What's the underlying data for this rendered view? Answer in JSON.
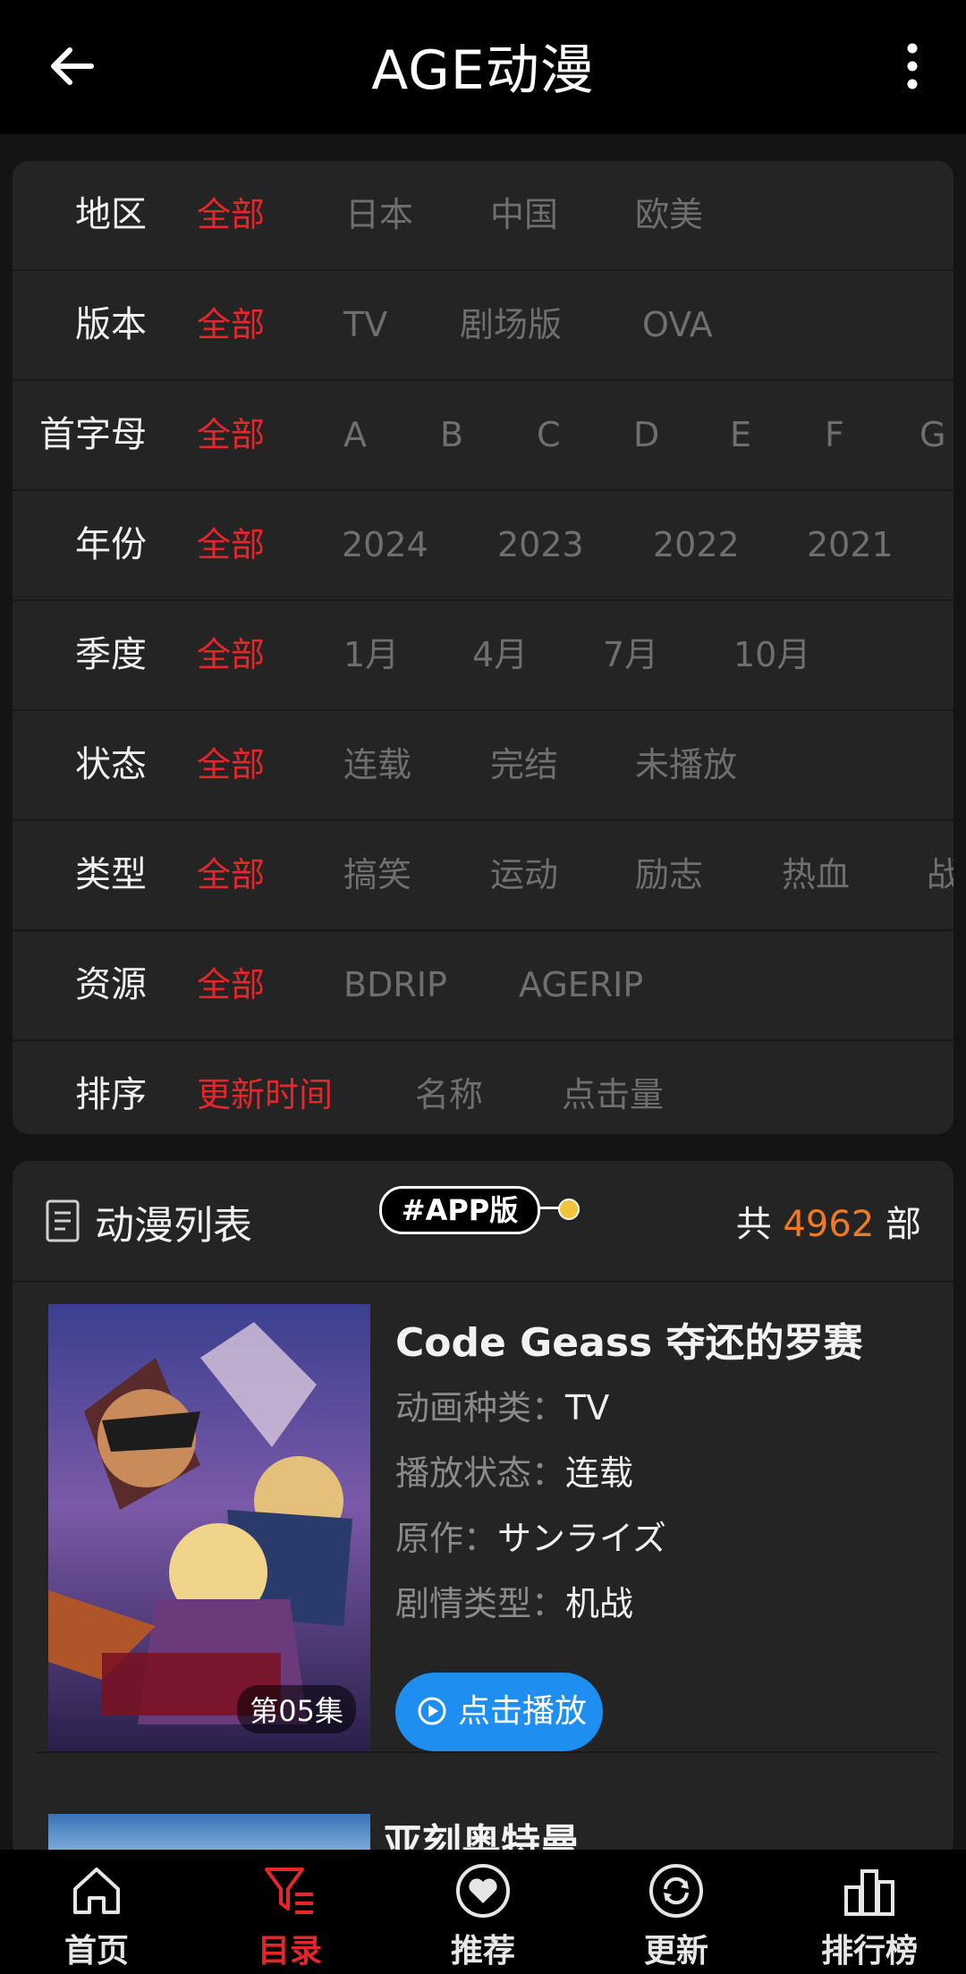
{
  "app": {
    "title": "AGE动漫"
  },
  "filters": [
    {
      "label": "地区",
      "options": [
        "全部",
        "日本",
        "中国",
        "欧美"
      ],
      "selected": 0
    },
    {
      "label": "版本",
      "options": [
        "全部",
        "TV",
        "剧场版",
        "OVA"
      ],
      "selected": 0
    },
    {
      "label": "首字母",
      "options": [
        "全部",
        "A",
        "B",
        "C",
        "D",
        "E",
        "F",
        "G"
      ],
      "selected": 0
    },
    {
      "label": "年份",
      "options": [
        "全部",
        "2024",
        "2023",
        "2022",
        "2021"
      ],
      "selected": 0
    },
    {
      "label": "季度",
      "options": [
        "全部",
        "1月",
        "4月",
        "7月",
        "10月"
      ],
      "selected": 0
    },
    {
      "label": "状态",
      "options": [
        "全部",
        "连载",
        "完结",
        "未播放"
      ],
      "selected": 0
    },
    {
      "label": "类型",
      "options": [
        "全部",
        "搞笑",
        "运动",
        "励志",
        "热血",
        "战"
      ],
      "selected": 0
    },
    {
      "label": "资源",
      "options": [
        "全部",
        "BDRIP",
        "AGERIP"
      ],
      "selected": 0
    },
    {
      "label": "排序",
      "options": [
        "更新时间",
        "名称",
        "点击量"
      ],
      "selected": 0
    }
  ],
  "list": {
    "title": "动漫列表",
    "count_prefix": "共",
    "count": "4962",
    "count_suffix": "部",
    "tag": "#APP版",
    "items": [
      {
        "name": "Code Geass 夺还的罗赛",
        "episode_badge": "第05集",
        "fields": [
          {
            "key": "动画种类：",
            "value": "TV"
          },
          {
            "key": "播放状态：",
            "value": "连载"
          },
          {
            "key": "原作：",
            "value": "サンライズ"
          },
          {
            "key": "剧情类型：",
            "value": "机战"
          }
        ],
        "play_label": "点击播放"
      },
      {
        "name": "亚刻奥特曼"
      }
    ]
  },
  "colors": {
    "accent_red": "#e5262b",
    "count_orange": "#f07a24",
    "play_blue": "#1e8ff0"
  },
  "bottom_nav": [
    {
      "label": "首页",
      "icon": "home-icon"
    },
    {
      "label": "目录",
      "icon": "catalog-filter-icon",
      "active": true
    },
    {
      "label": "推荐",
      "icon": "heart-icon"
    },
    {
      "label": "更新",
      "icon": "refresh-icon"
    },
    {
      "label": "排行榜",
      "icon": "ranking-icon"
    }
  ]
}
